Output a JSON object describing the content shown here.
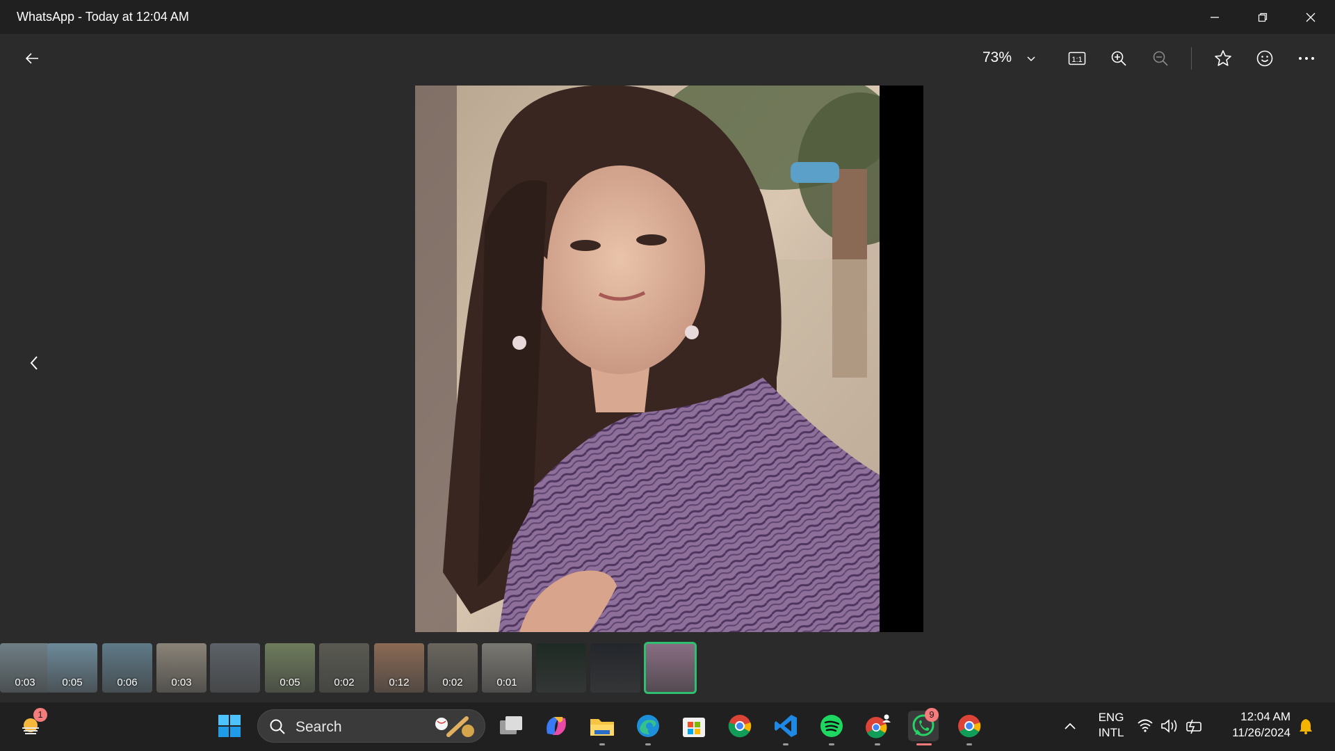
{
  "window": {
    "title": "WhatsApp - Today at 12:04 AM",
    "controls": [
      "minimize",
      "restore",
      "close"
    ]
  },
  "toolbar": {
    "zoom": "73%",
    "icons": [
      "back-arrow",
      "zoom-dropdown-chevron",
      "actual-size",
      "zoom-in",
      "zoom-out",
      "favorite-star",
      "emoji-face",
      "more-options"
    ]
  },
  "viewer": {
    "photo_description_alt": "Selfie photo",
    "nav_prev_icon": "chevron-left"
  },
  "filmstrip": {
    "items": [
      {
        "duration": "0:03",
        "color": "#6f7f86"
      },
      {
        "duration": "0:05",
        "color": "#6d8a9a"
      },
      {
        "duration": "0:06",
        "color": "#5f7a88"
      },
      {
        "duration": "0:03",
        "color": "#8a8378"
      },
      {
        "duration": "",
        "color": "#5c6268"
      },
      {
        "duration": "0:05",
        "color": "#6e7c5c"
      },
      {
        "duration": "0:02",
        "color": "#5a5a52"
      },
      {
        "duration": "0:12",
        "color": "#8a6a55"
      },
      {
        "duration": "0:02",
        "color": "#6a665e"
      },
      {
        "duration": "0:01",
        "color": "#7a7872"
      },
      {
        "duration": "",
        "color": "#1e2a24"
      },
      {
        "duration": "",
        "color": "#23262b"
      },
      {
        "duration": "",
        "color": "#8a6e84",
        "selected": true
      }
    ]
  },
  "taskbar": {
    "widgets_badge": "1",
    "search_placeholder": "Search",
    "whatsapp_badge": "9",
    "apps": [
      "start",
      "search",
      "task-view",
      "copilot",
      "file-explorer",
      "edge",
      "microsoft-store",
      "chrome",
      "vscode",
      "spotify",
      "chrome-profile",
      "whatsapp",
      "chrome"
    ],
    "tray": {
      "language_line1": "ENG",
      "language_line2": "INTL",
      "time": "12:04 AM",
      "date": "11/26/2024"
    }
  },
  "colors": {
    "accent_green": "#2fbf71",
    "badge_red": "#f47c7c",
    "background": "#2b2b2b",
    "titlebar": "#202020"
  }
}
